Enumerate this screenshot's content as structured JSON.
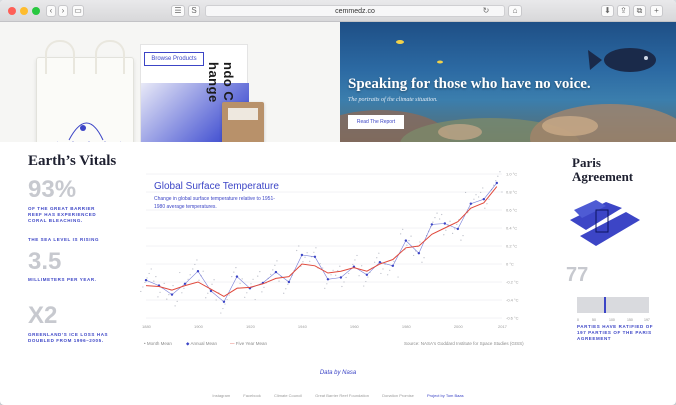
{
  "browser": {
    "url": "cemmedz.co",
    "sidebar_btn": "☰",
    "s_btn": "S"
  },
  "hero": {
    "browse_label": "Browse Products",
    "poster_text": "ndo Climate hange",
    "headline": "Speaking for those who have no voice.",
    "subheadline": "The portraits of the climate situation.",
    "report_label": "Read The Report"
  },
  "vitals": {
    "title": "Earth’s Vitals",
    "stat1_value": "93%",
    "stat1_caption": "Of the Great Barrier Reef has experienced coral bleaching.",
    "stat2_caption_top": "The sea level is rising",
    "stat2_value": "3.5",
    "stat2_caption": "Millimeters per year.",
    "stat3_value": "X2",
    "stat3_caption": "Greenland’s ice loss has doubled from 1996–2005."
  },
  "chart_data": {
    "type": "line",
    "title": "Global Surface Temperature",
    "subtitle": "Change in global surface temperature relative to 1951-1980 average temperatures.",
    "x": [
      1880,
      1885,
      1890,
      1895,
      1900,
      1905,
      1910,
      1915,
      1920,
      1925,
      1930,
      1935,
      1940,
      1945,
      1950,
      1955,
      1960,
      1965,
      1970,
      1975,
      1980,
      1985,
      1990,
      1995,
      2000,
      2005,
      2010,
      2015
    ],
    "series": [
      {
        "name": "Annual Mean",
        "values": [
          -0.18,
          -0.24,
          -0.34,
          -0.22,
          -0.08,
          -0.3,
          -0.42,
          -0.14,
          -0.27,
          -0.21,
          -0.09,
          -0.2,
          0.1,
          0.08,
          -0.17,
          -0.15,
          -0.03,
          -0.12,
          0.02,
          -0.02,
          0.26,
          0.12,
          0.44,
          0.45,
          0.39,
          0.67,
          0.72,
          0.9
        ]
      },
      {
        "name": "Five Year Mean",
        "values": [
          -0.24,
          -0.25,
          -0.29,
          -0.24,
          -0.2,
          -0.28,
          -0.36,
          -0.27,
          -0.26,
          -0.22,
          -0.16,
          -0.14,
          0.0,
          -0.02,
          -0.1,
          -0.08,
          -0.04,
          -0.08,
          0.0,
          0.05,
          0.18,
          0.2,
          0.33,
          0.4,
          0.47,
          0.62,
          0.68,
          0.86
        ]
      }
    ],
    "xlim": [
      1880,
      2017
    ],
    "ylim": [
      -0.6,
      1.0
    ],
    "y_ticks": [
      "1.0 °C",
      "0.8 °C",
      "0.6 °C",
      "0.4 °C",
      "0.2 °C",
      "0 °C",
      "-0.2 °C",
      "-0.4 °C",
      "-0.6 °C"
    ],
    "x_ticks": [
      "1880",
      "1900",
      "1920",
      "1940",
      "1960",
      "1980",
      "2000",
      "2017"
    ],
    "legend": [
      "Month Mean",
      "Annual Mean",
      "Five Year Mean"
    ],
    "source": "Source: NASA's Goddard Institute for Space Studies (GISS)"
  },
  "paris": {
    "title": "Paris Agreement",
    "value": "77",
    "ratified_fraction": 0.39,
    "caption": "Parties have ratified of 197 parties of the Paris agreement",
    "bar_ticks": [
      "0",
      "50",
      "100",
      "150",
      "197"
    ]
  },
  "data_by": "Data by Nasa",
  "footer": [
    "Instagram",
    "Facebook",
    "Climate Council",
    "Great Barrier Reef Foundation",
    "Donation Promise",
    "Project by Tom Baas"
  ],
  "colors": {
    "accent": "#3c45c6",
    "muted": "#c7c9cf",
    "trend": "#e0483b"
  }
}
